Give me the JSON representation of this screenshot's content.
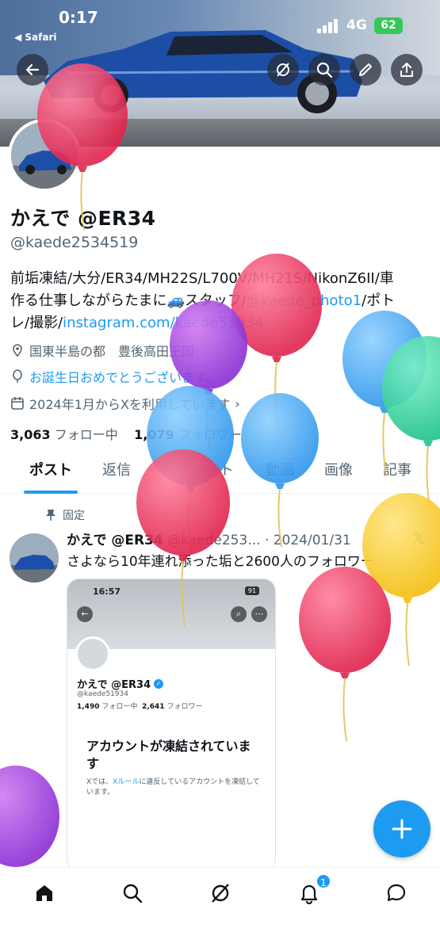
{
  "status_bar": {
    "time": "0:17",
    "back_app": "◀ Safari",
    "network": "4G",
    "battery": "62"
  },
  "profile": {
    "display_name": "かえで @ER34",
    "handle": "@kaede2534519",
    "bio_line1": "前垢凍結/大分/ER34/MH22S/L700V/MH21S/NikonZ6II/車",
    "bio_line2_a": "作る仕事しながらたまに",
    "bio_line2_b": "スタッフ/",
    "bio_link1": "@kaede_photo1",
    "bio_line2_c": "/ポト",
    "bio_line3_a": "レ/撮影/",
    "bio_link2": "instagram.com/kaede51934",
    "location": "国東半島の都　豊後高田王国",
    "birthday": "お誕生日おめでとうございます。",
    "joined": "2024年1月からXを利用しています",
    "following_count": "3,063",
    "following_label": "フォロー中",
    "followers_count": "1,079",
    "followers_label": "フォロワー"
  },
  "tabs": [
    {
      "label": "ポスト"
    },
    {
      "label": "返信"
    },
    {
      "label": "ハイライト"
    },
    {
      "label": "動画"
    },
    {
      "label": "画像"
    },
    {
      "label": "記事"
    }
  ],
  "pinned_post": {
    "pinned_label": "固定",
    "author": "かえで @ER34",
    "meta": "@kaede253... · 2024/01/31",
    "text": "さよなら10年連れ添った垢と2600人のフォロワー",
    "x_logo": "𝕏",
    "embed": {
      "time": "16:57",
      "battery": "91",
      "name": "かえで @ER34",
      "handle": "@kaede51934",
      "following_count": "1,490",
      "following_label": "フォロー中",
      "followers_count": "2,641",
      "followers_label": "フォロワー",
      "title": "アカウントが凍結されています",
      "desc_a": "Xでは、",
      "desc_link": "Xルール",
      "desc_b": "に違反しているアカウントを凍結しています。"
    }
  },
  "notifications_badge": "1",
  "colors": {
    "accent": "#1d9bf0",
    "text": "#0f1419",
    "muted": "#536471"
  },
  "icons": [
    "back-icon",
    "grok-icon",
    "search-icon",
    "edit-icon",
    "share-icon",
    "location-icon",
    "balloon-icon",
    "calendar-icon",
    "pin-icon",
    "plus-icon",
    "home-icon",
    "nav-search-icon",
    "nav-grok-icon",
    "bell-icon",
    "messages-icon"
  ]
}
